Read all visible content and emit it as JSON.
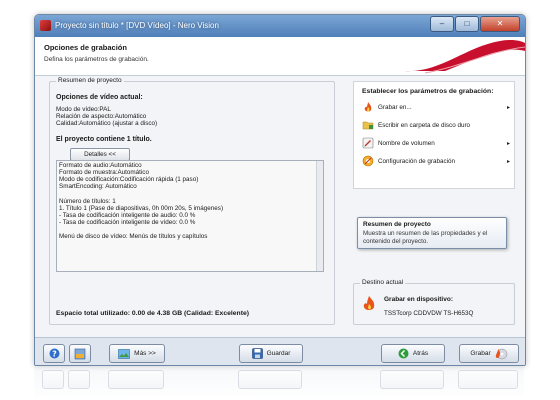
{
  "window": {
    "title": "Proyecto sin título * [DVD Vídeo] - Nero Vision",
    "controls": {
      "minimize": "–",
      "maximize": "□",
      "close": "✕"
    }
  },
  "header": {
    "title": "Opciones de grabación",
    "subtitle": "Defina los parámetros de grabación."
  },
  "summary": {
    "legend": "Resumen de proyecto",
    "video_options_title": "Opciones de vídeo actual:",
    "video_lines": [
      "Modo de vídeo:PAL",
      "Relación de aspecto:Automático",
      "Calidad:Automático (ajustar a disco)"
    ],
    "project_contains": "El proyecto contiene 1 título.",
    "details_button": "Detalles <<",
    "details_lines": [
      "Formato de audio:Automático",
      "Formato de muestra:Automático",
      "Modo de codificación:Codificación rápida (1 paso)",
      "SmartEncoding: Automático",
      "",
      "Número de títulos: 1",
      "1. Título 1 (Pase de diapositivas, 0h 00m 20s, 5 imágenes)",
      "- Tasa de codificación inteligente de audio: 0.0 %",
      "- Tasa de codificación inteligente de vídeo: 0.0 %",
      "",
      "Menú de disco de vídeo: Menús de títulos y capítulos"
    ],
    "total_space": "Espacio total utilizado: 0.00 de 4.38 GB (Calidad: Excelente)"
  },
  "params": {
    "title": "Establecer los parámetros de grabación:",
    "items": [
      {
        "label": "Grabar en...",
        "icon": "burn-flame-icon",
        "arrow": "▸"
      },
      {
        "label": "Escribir en carpeta de disco duro",
        "icon": "folder-icon",
        "arrow": ""
      },
      {
        "label": "Nombre de volumen",
        "icon": "volume-name-icon",
        "arrow": "▸"
      },
      {
        "label": "Configuración de grabación",
        "icon": "settings-icon",
        "arrow": "▸"
      }
    ]
  },
  "tooltip": {
    "title": "Resumen de proyecto",
    "text": "Muestra un resumen de las propiedades y el contenido del proyecto."
  },
  "destination": {
    "legend": "Destino actual",
    "label": "Grabar en dispositivo:",
    "device": "TSSTcorp CDDVDW TS-H653Q"
  },
  "bottom": {
    "more": "Más >>",
    "save": "Guardar",
    "back": "Atrás",
    "burn": "Grabar"
  },
  "colors": {
    "accent": "#c8102e",
    "titlebar": "#4f7fb8"
  }
}
